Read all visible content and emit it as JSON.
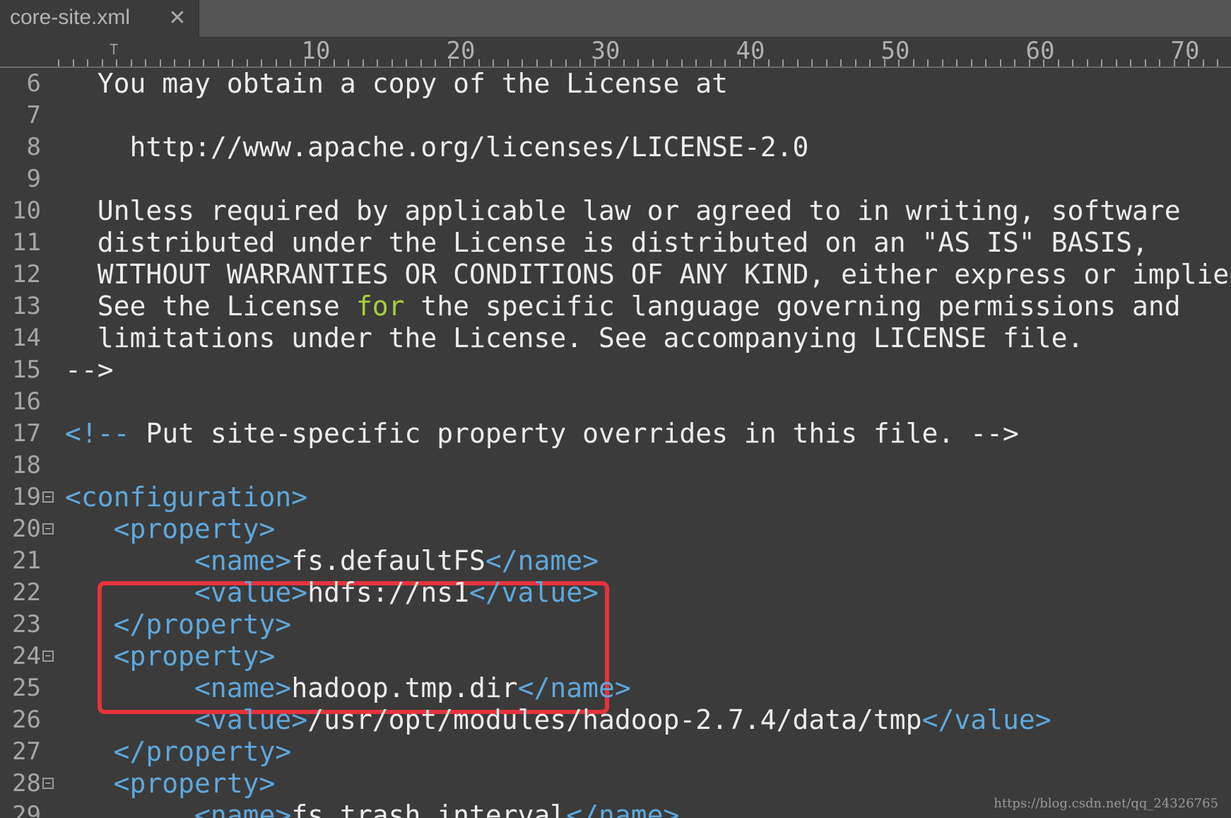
{
  "tab": {
    "title": "core-site.xml",
    "close_glyph": "✕"
  },
  "ruler": {
    "labels": [
      "10",
      "20",
      "30",
      "40",
      "50",
      "60",
      "70"
    ],
    "caret": "T"
  },
  "colors": {
    "background": "#3b3b3b",
    "plain": "#ececec",
    "tag": "#5fa8dc",
    "keyword": "#a6d13a",
    "line_number": "#a6a6a6",
    "highlight_border": "#e5333d"
  },
  "lines": [
    {
      "n": "6",
      "fold": false,
      "indent": "  ",
      "tokens": [
        [
          "plain",
          "You may obtain a copy of the License at"
        ]
      ]
    },
    {
      "n": "7",
      "fold": false,
      "indent": "",
      "tokens": []
    },
    {
      "n": "8",
      "fold": false,
      "indent": "    ",
      "tokens": [
        [
          "plain",
          "http://www.apache.org/licenses/LICENSE-2.0"
        ]
      ]
    },
    {
      "n": "9",
      "fold": false,
      "indent": "",
      "tokens": []
    },
    {
      "n": "10",
      "fold": false,
      "indent": "  ",
      "tokens": [
        [
          "plain",
          "Unless required by applicable law or agreed to in writing, software"
        ]
      ]
    },
    {
      "n": "11",
      "fold": false,
      "indent": "  ",
      "tokens": [
        [
          "plain",
          "distributed under the License is distributed on an \"AS IS\" BASIS,"
        ]
      ]
    },
    {
      "n": "12",
      "fold": false,
      "indent": "  ",
      "tokens": [
        [
          "plain",
          "WITHOUT WARRANTIES OR CONDITIONS OF ANY KIND, either express or implied"
        ]
      ]
    },
    {
      "n": "13",
      "fold": false,
      "indent": "  ",
      "tokens": [
        [
          "plain",
          "See the License "
        ],
        [
          "kw",
          "for"
        ],
        [
          "plain",
          " the specific language governing permissions and"
        ]
      ]
    },
    {
      "n": "14",
      "fold": false,
      "indent": "  ",
      "tokens": [
        [
          "plain",
          "limitations under the License. See accompanying LICENSE file."
        ]
      ]
    },
    {
      "n": "15",
      "fold": false,
      "indent": "",
      "tokens": [
        [
          "plain",
          "-->"
        ]
      ]
    },
    {
      "n": "16",
      "fold": false,
      "indent": "",
      "tokens": []
    },
    {
      "n": "17",
      "fold": false,
      "indent": "",
      "tokens": [
        [
          "com",
          "<!--"
        ],
        [
          "plain",
          " Put site-specific property overrides in this file. -->"
        ]
      ]
    },
    {
      "n": "18",
      "fold": false,
      "indent": "",
      "tokens": []
    },
    {
      "n": "19",
      "fold": true,
      "indent": "",
      "tokens": [
        [
          "tag",
          "<configuration>"
        ]
      ]
    },
    {
      "n": "20",
      "fold": true,
      "indent": "   ",
      "tokens": [
        [
          "tag",
          "<property>"
        ]
      ]
    },
    {
      "n": "21",
      "fold": false,
      "indent": "        ",
      "tokens": [
        [
          "tag",
          "<name>"
        ],
        [
          "plain",
          "fs.defaultFS"
        ],
        [
          "tag",
          "</name>"
        ]
      ]
    },
    {
      "n": "22",
      "fold": false,
      "indent": "        ",
      "tokens": [
        [
          "tag",
          "<value>"
        ],
        [
          "plain",
          "hdfs://ns1"
        ],
        [
          "tag",
          "</value>"
        ]
      ]
    },
    {
      "n": "23",
      "fold": false,
      "indent": "   ",
      "tokens": [
        [
          "tag",
          "</property>"
        ]
      ]
    },
    {
      "n": "24",
      "fold": true,
      "indent": "   ",
      "tokens": [
        [
          "tag",
          "<property>"
        ]
      ]
    },
    {
      "n": "25",
      "fold": false,
      "indent": "        ",
      "tokens": [
        [
          "tag",
          "<name>"
        ],
        [
          "plain",
          "hadoop.tmp.dir"
        ],
        [
          "tag",
          "</name>"
        ]
      ]
    },
    {
      "n": "26",
      "fold": false,
      "indent": "        ",
      "tokens": [
        [
          "tag",
          "<value>"
        ],
        [
          "plain",
          "/usr/opt/modules/hadoop-2.7.4/data/tmp"
        ],
        [
          "tag",
          "</value>"
        ]
      ]
    },
    {
      "n": "27",
      "fold": false,
      "indent": "   ",
      "tokens": [
        [
          "tag",
          "</property>"
        ]
      ]
    },
    {
      "n": "28",
      "fold": true,
      "indent": "   ",
      "tokens": [
        [
          "tag",
          "<property>"
        ]
      ]
    },
    {
      "n": "29",
      "fold": false,
      "indent": "        ",
      "tokens": [
        [
          "tag",
          "<name>"
        ],
        [
          "plain",
          "fs.trash.interval"
        ],
        [
          "tag",
          "</name>"
        ]
      ]
    }
  ],
  "watermark": "https://blog.csdn.net/qq_24326765"
}
